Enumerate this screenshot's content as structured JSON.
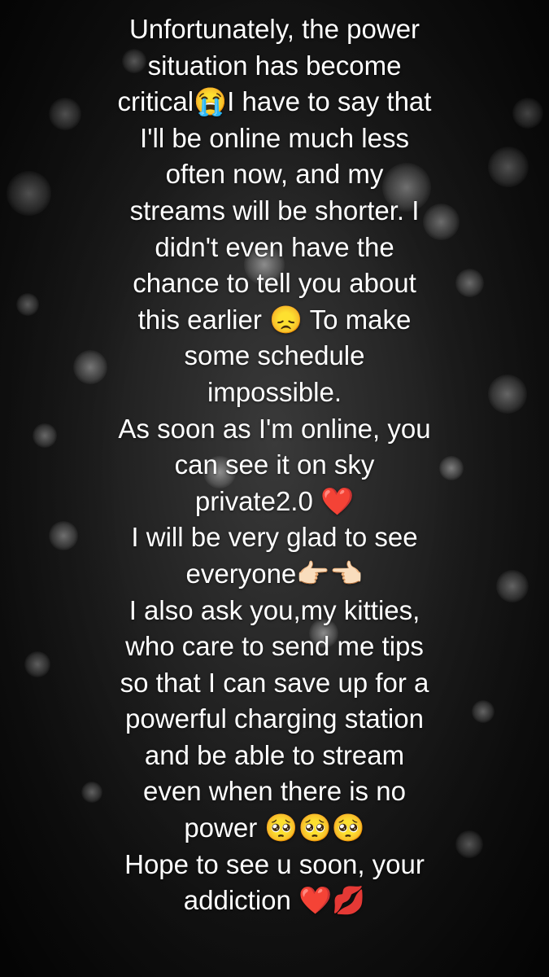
{
  "story": {
    "background": {
      "style": "black-and-white bokeh city lights",
      "colors": {
        "base": "#0d0d0d",
        "light": "#dcdcdc"
      }
    },
    "caption_lines": [
      "Unfortunately, the power",
      "situation has become",
      "critical😭I have to say that",
      "I'll be online much less",
      "often now, and my",
      "streams will be shorter. I",
      "didn't even have the",
      "chance to tell you about",
      "this earlier 😞 To make",
      "some schedule",
      "impossible.",
      "As soon as I'm online, you",
      "can see it on sky",
      "private2.0 ❤️",
      "I will be very glad to see",
      "everyone👉🏻👈🏻",
      "I also ask you,my kitties,",
      "who care to send me tips",
      "so that I can save up for a",
      "powerful charging station",
      "and be able to stream",
      "even when there is no",
      "power 🥺🥺🥺",
      "Hope to see u soon, your",
      "addiction ❤️💋"
    ]
  }
}
